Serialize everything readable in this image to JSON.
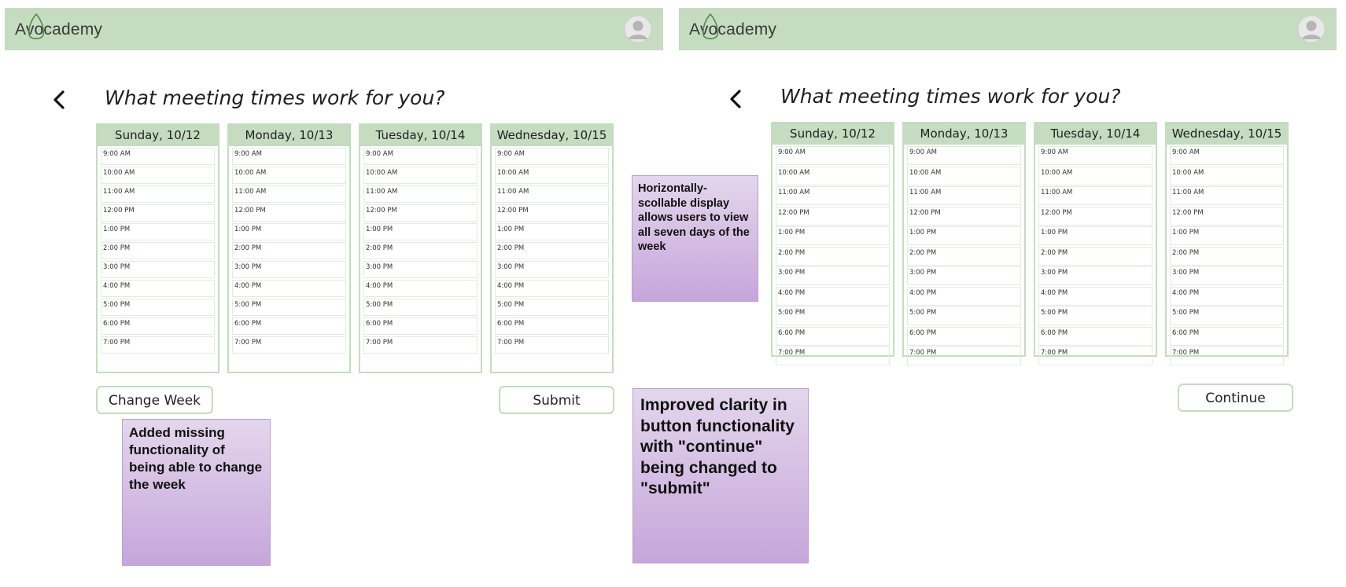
{
  "app": {
    "logo_text": "Avocademy"
  },
  "screens": {
    "left": {
      "title": "What meeting times work for you?",
      "days": [
        {
          "label": "Sunday, 10/12"
        },
        {
          "label": "Monday, 10/13"
        },
        {
          "label": "Tuesday, 10/14"
        },
        {
          "label": "Wednesday, 10/15"
        }
      ],
      "change_week_label": "Change Week",
      "submit_label": "Submit"
    },
    "right": {
      "title": "What meeting times work for you?",
      "days": [
        {
          "label": "Sunday, 10/12"
        },
        {
          "label": "Monday, 10/13"
        },
        {
          "label": "Tuesday, 10/14"
        },
        {
          "label": "Wednesday, 10/15"
        }
      ],
      "continue_label": "Continue"
    }
  },
  "time_slots": [
    "9:00 AM",
    "10:00 AM",
    "11:00 AM",
    "12:00 PM",
    "1:00 PM",
    "2:00 PM",
    "3:00 PM",
    "4:00 PM",
    "5:00 PM",
    "6:00 PM",
    "7:00 PM"
  ],
  "annotations": {
    "change_week": "Added missing functionality of being able to change the week",
    "scroll": "Horizontally-scollable display allows users to view all seven days of the week",
    "button": "Improved clarity in button functionality with \"continue\" being changed to \"submit\""
  },
  "colors": {
    "header_green": "#c5dcc0",
    "note_purple": "#c6a6da"
  },
  "icons": [
    "avocado-logo-icon",
    "user-avatar-icon",
    "chevron-left-icon"
  ]
}
